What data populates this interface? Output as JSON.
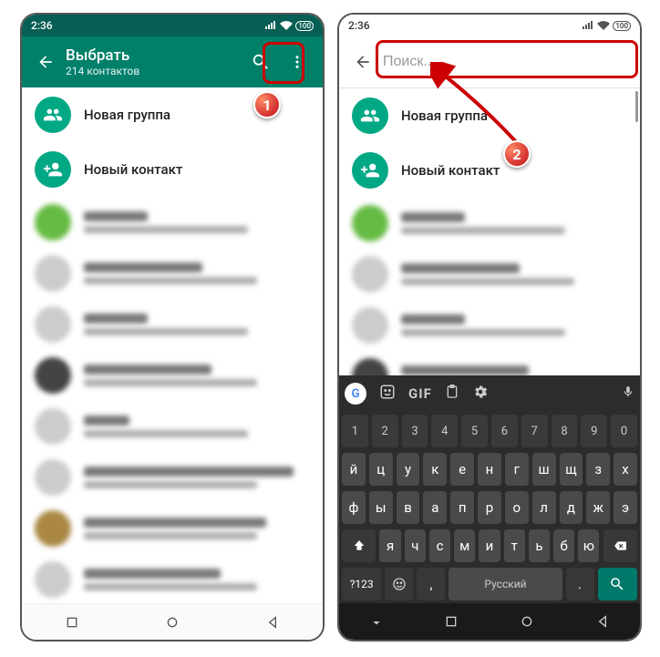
{
  "statusbar": {
    "time": "2:36",
    "battery": "100"
  },
  "screen1": {
    "title": "Выбрать",
    "subtitle": "214 контактов",
    "new_group": "Новая группа",
    "new_contact": "Новый контакт"
  },
  "screen2": {
    "search_placeholder": "Поиск...",
    "new_group": "Новая группа",
    "new_contact": "Новый контакт"
  },
  "keyboard": {
    "toolbar_gif": "GIF",
    "space_label": "Русский",
    "symbols_key": "?123",
    "nums": [
      "1",
      "2",
      "3",
      "4",
      "5",
      "6",
      "7",
      "8",
      "9",
      "0"
    ],
    "row1": [
      "й",
      "ц",
      "у",
      "к",
      "е",
      "н",
      "г",
      "ш",
      "щ",
      "з",
      "х"
    ],
    "row2": [
      "ф",
      "ы",
      "в",
      "а",
      "п",
      "р",
      "о",
      "л",
      "д",
      "ж",
      "э"
    ],
    "row3": [
      "я",
      "ч",
      "с",
      "м",
      "и",
      "т",
      "ь",
      "б",
      "ю"
    ]
  },
  "badges": {
    "one": "1",
    "two": "2"
  }
}
